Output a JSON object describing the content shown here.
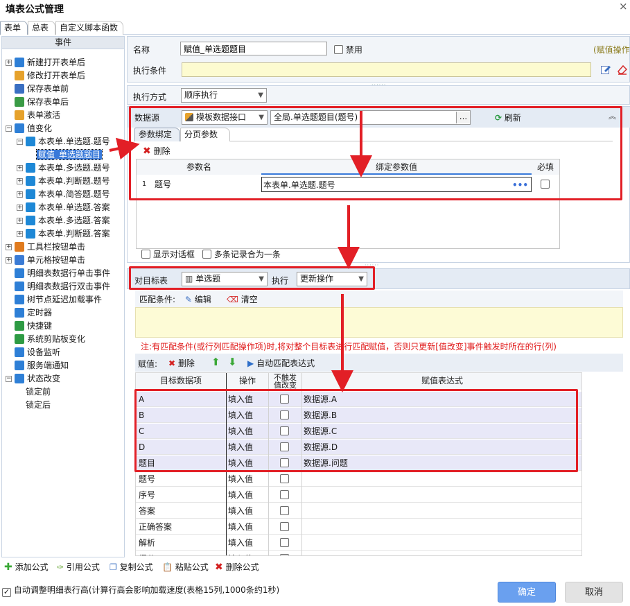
{
  "window": {
    "title": "填表公式管理",
    "close": "×"
  },
  "tabs": [
    "表单",
    "总表",
    "自定义脚本函数"
  ],
  "tree": {
    "header": "事件",
    "items": [
      {
        "label": "新建打开表单后",
        "icon": "user-icon",
        "color": "#2e7fd6"
      },
      {
        "label": "修改打开表单后",
        "icon": "folder-icon",
        "color": "#e6a22c"
      },
      {
        "label": "保存表单前",
        "icon": "doc-icon",
        "color": "#3a6fc2"
      },
      {
        "label": "保存表单后",
        "icon": "doc-check-icon",
        "color": "#3a9b45"
      },
      {
        "label": "表单激活",
        "icon": "folder-open-icon",
        "color": "#e6a22c"
      },
      {
        "label": "值变化",
        "icon": "number-icon",
        "color": "#2e7fd6"
      },
      {
        "label": "本表单.单选题.题号",
        "icon": "layers-icon",
        "color": "#1e88d6"
      },
      {
        "label": "赋值_单选题题目",
        "icon": "",
        "color": ""
      },
      {
        "label": "本表单.多选题.题号",
        "icon": "layers-icon",
        "color": "#1e88d6"
      },
      {
        "label": "本表单.判断题.题号",
        "icon": "layers-icon",
        "color": "#1e88d6"
      },
      {
        "label": "本表单.简答题.题号",
        "icon": "layers-icon",
        "color": "#1e88d6"
      },
      {
        "label": "本表单.单选题.答案",
        "icon": "layers-icon",
        "color": "#1e88d6"
      },
      {
        "label": "本表单.多选题.答案",
        "icon": "layers-icon",
        "color": "#1e88d6"
      },
      {
        "label": "本表单.判断题.答案",
        "icon": "layers-icon",
        "color": "#1e88d6"
      },
      {
        "label": "工具栏按钮单击",
        "icon": "tools-icon",
        "color": "#e07b1f"
      },
      {
        "label": "单元格按钮单击",
        "icon": "dots-icon",
        "color": "#3a7bd5"
      },
      {
        "label": "明细表数据行单击事件",
        "icon": "ring-icon",
        "color": "#2e7fd6"
      },
      {
        "label": "明细表数据行双击事件",
        "icon": "ring-icon",
        "color": "#2e7fd6"
      },
      {
        "label": "树节点延迟加载事件",
        "icon": "ring-icon",
        "color": "#2e7fd6"
      },
      {
        "label": "定时器",
        "icon": "timer-icon",
        "color": "#2e7fd6"
      },
      {
        "label": "快捷键",
        "icon": "share-icon",
        "color": "#2e9b44"
      },
      {
        "label": "系统剪贴板变化",
        "icon": "scissors-icon",
        "color": "#2e9b44"
      },
      {
        "label": "设备监听",
        "icon": "monitor-icon",
        "color": "#2e7fd6"
      },
      {
        "label": "服务端通知",
        "icon": "bell-icon",
        "color": "#2e7fd6"
      },
      {
        "label": "状态改变",
        "icon": "t-icon",
        "color": "#2e7fd6"
      },
      {
        "label": "锁定前",
        "icon": "",
        "color": ""
      },
      {
        "label": "锁定后",
        "icon": "",
        "color": ""
      }
    ]
  },
  "form": {
    "name_label": "名称",
    "name_value": "赋值_单选题题目",
    "disable_label": "禁用",
    "op_type": "(赋值操作",
    "condition_label": "执行条件",
    "mode_label": "执行方式",
    "mode_value": "顺序执行"
  },
  "datasource": {
    "label": "数据源",
    "type_value": "模板数据接口",
    "source_value": "全局.单选题题目(题号)",
    "browse": "...",
    "refresh": "刷新",
    "tabs": [
      "参数绑定",
      "分页参数"
    ],
    "delete": "删除",
    "columns": [
      "参数名",
      "绑定参数值",
      "必填"
    ],
    "rows": [
      {
        "index": "1",
        "name": "题号",
        "value": "本表单.单选题.题号",
        "ellipsis": "•••"
      }
    ],
    "show_dialog": "显示对话框",
    "merge_records": "多条记录合为一条"
  },
  "target": {
    "label": "对目标表",
    "table_value": "单选题",
    "exec_label": "执行",
    "exec_value": "更新操作",
    "match_label": "匹配条件:",
    "edit": "编辑",
    "clear": "清空",
    "note": "注:有匹配条件(或行列匹配操作项)时,将对整个目标表进行匹配赋值，否则只更新[值改变]事件触发时所在的行(列)"
  },
  "assign": {
    "label": "赋值:",
    "delete": "删除",
    "auto_match": "自动匹配表达式",
    "columns": [
      "目标数据项",
      "操作",
      "不触发\n值改变",
      "赋值表达式"
    ],
    "rows": [
      {
        "item": "A",
        "op": "填入值",
        "expr": "数据源.A"
      },
      {
        "item": "B",
        "op": "填入值",
        "expr": "数据源.B"
      },
      {
        "item": "C",
        "op": "填入值",
        "expr": "数据源.C"
      },
      {
        "item": "D",
        "op": "填入值",
        "expr": "数据源.D"
      },
      {
        "item": "题目",
        "op": "填入值",
        "expr": "数据源.问题"
      },
      {
        "item": "题号",
        "op": "填入值",
        "expr": ""
      },
      {
        "item": "序号",
        "op": "填入值",
        "expr": ""
      },
      {
        "item": "答案",
        "op": "填入值",
        "expr": ""
      },
      {
        "item": "正确答案",
        "op": "填入值",
        "expr": ""
      },
      {
        "item": "解析",
        "op": "填入值",
        "expr": ""
      },
      {
        "item": "得分",
        "op": "填入值",
        "expr": ""
      }
    ]
  },
  "footer": {
    "add": "添加公式",
    "ref": "引用公式",
    "copy": "复制公式",
    "paste": "粘贴公式",
    "del": "删除公式",
    "auto_height": "自动调整明细表行高(计算行高会影响加载速度(表格15列,1000条约1秒)",
    "ok": "确定",
    "cancel": "取消"
  },
  "colors": {
    "accent": "#3879d9",
    "highlight_red": "#e21f26",
    "ok_button": "#6aa0ef",
    "note_red": "#e01818",
    "selected_row": "#e8e8f8"
  }
}
